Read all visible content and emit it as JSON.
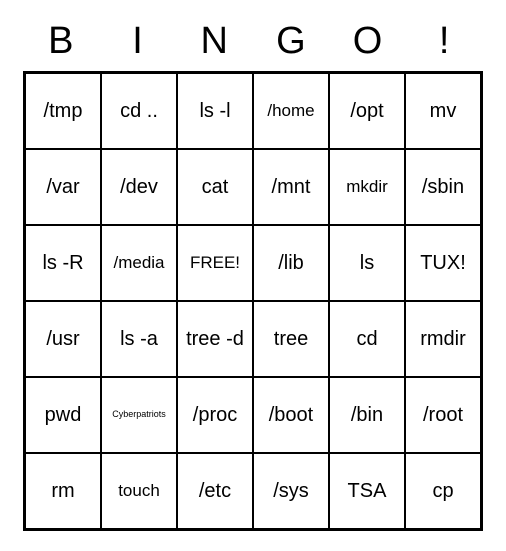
{
  "header": [
    "B",
    "I",
    "N",
    "G",
    "O",
    "!"
  ],
  "grid": [
    [
      {
        "text": "/tmp",
        "size": ""
      },
      {
        "text": "cd ..",
        "size": ""
      },
      {
        "text": "ls -l",
        "size": ""
      },
      {
        "text": "/home",
        "size": "small"
      },
      {
        "text": "/opt",
        "size": ""
      },
      {
        "text": "mv",
        "size": ""
      }
    ],
    [
      {
        "text": "/var",
        "size": ""
      },
      {
        "text": "/dev",
        "size": ""
      },
      {
        "text": "cat",
        "size": ""
      },
      {
        "text": "/mnt",
        "size": ""
      },
      {
        "text": "mkdir",
        "size": "small"
      },
      {
        "text": "/sbin",
        "size": ""
      }
    ],
    [
      {
        "text": "ls -R",
        "size": ""
      },
      {
        "text": "/media",
        "size": "small"
      },
      {
        "text": "FREE!",
        "size": "small"
      },
      {
        "text": "/lib",
        "size": ""
      },
      {
        "text": "ls",
        "size": ""
      },
      {
        "text": "TUX!",
        "size": ""
      }
    ],
    [
      {
        "text": "/usr",
        "size": ""
      },
      {
        "text": "ls -a",
        "size": ""
      },
      {
        "text": "tree -d",
        "size": ""
      },
      {
        "text": "tree",
        "size": ""
      },
      {
        "text": "cd",
        "size": ""
      },
      {
        "text": "rmdir",
        "size": ""
      }
    ],
    [
      {
        "text": "pwd",
        "size": ""
      },
      {
        "text": "Cyberpatriots",
        "size": "tiny"
      },
      {
        "text": "/proc",
        "size": ""
      },
      {
        "text": "/boot",
        "size": ""
      },
      {
        "text": "/bin",
        "size": ""
      },
      {
        "text": "/root",
        "size": ""
      }
    ],
    [
      {
        "text": "rm",
        "size": ""
      },
      {
        "text": "touch",
        "size": "small"
      },
      {
        "text": "/etc",
        "size": ""
      },
      {
        "text": "/sys",
        "size": ""
      },
      {
        "text": "TSA",
        "size": ""
      },
      {
        "text": "cp",
        "size": ""
      }
    ]
  ]
}
